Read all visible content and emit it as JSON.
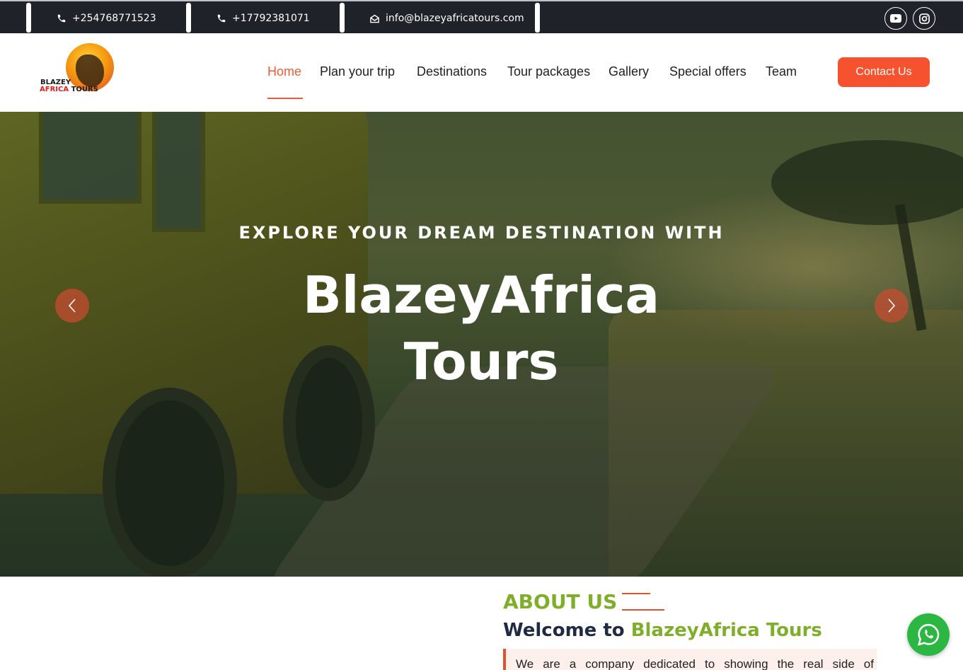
{
  "topbar": {
    "phone1": "+254768771523",
    "phone2": "+17792381071",
    "email": "info@blazeyafricatours.com",
    "social": [
      "youtube-icon",
      "instagram-icon"
    ]
  },
  "logo": {
    "line1": "BLAZEY",
    "line2a": "AFRICA",
    "line2b": "TOURS"
  },
  "nav": {
    "items": [
      {
        "label": "Home",
        "active": true
      },
      {
        "label": "Plan your trip"
      },
      {
        "label": "Destinations"
      },
      {
        "label": "Tour packages"
      },
      {
        "label": "Gallery"
      },
      {
        "label": "Special offers"
      },
      {
        "label": "Team"
      }
    ],
    "cta": "Contact Us"
  },
  "hero": {
    "subtitle": "EXPLORE YOUR DREAM DESTINATION WITH",
    "title": "BlazeyAfrica Tours"
  },
  "about": {
    "label": "ABOUT US",
    "welcome_prefix": "Welcome to",
    "welcome_brand": "BlazeyAfrica Tours",
    "text": "We are a company dedicated to showing the real side of"
  },
  "colors": {
    "accent": "#f05a36",
    "green": "#7fae2a",
    "topbar_bg": "#1f2229",
    "whatsapp": "#2bb741"
  }
}
